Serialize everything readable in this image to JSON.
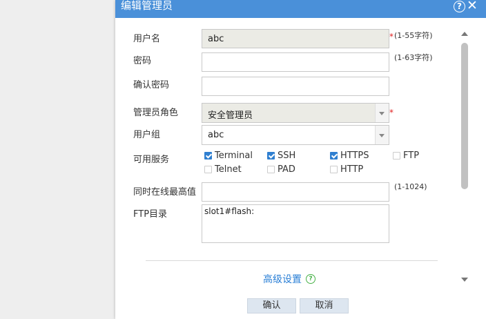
{
  "dialog": {
    "title": "编辑管理员",
    "help_icon": "?",
    "close_icon": "✕"
  },
  "form": {
    "username": {
      "label": "用户名",
      "value": "abc",
      "hint": "(1-55字符)",
      "required": "*"
    },
    "password": {
      "label": "密码",
      "value": "",
      "hint": "(1-63字符)"
    },
    "confirm_password": {
      "label": "确认密码",
      "value": ""
    },
    "role": {
      "label": "管理员角色",
      "value": "安全管理员",
      "required": "*"
    },
    "user_group": {
      "label": "用户组",
      "value": "abc"
    },
    "services": {
      "label": "可用服务",
      "items": [
        {
          "label": "Terminal",
          "checked": true
        },
        {
          "label": "SSH",
          "checked": true
        },
        {
          "label": "HTTPS",
          "checked": true
        },
        {
          "label": "FTP",
          "checked": false
        },
        {
          "label": "Telnet",
          "checked": false
        },
        {
          "label": "PAD",
          "checked": false
        },
        {
          "label": "HTTP",
          "checked": false
        }
      ]
    },
    "max_online": {
      "label": "同时在线最高值",
      "value": "",
      "hint": "(1-1024)"
    },
    "ftp_dir": {
      "label": "FTP目录",
      "value": "slot1#flash:"
    }
  },
  "advanced": {
    "label": "高级设置",
    "icon": "?"
  },
  "buttons": {
    "confirm": "确认",
    "cancel": "取消"
  }
}
